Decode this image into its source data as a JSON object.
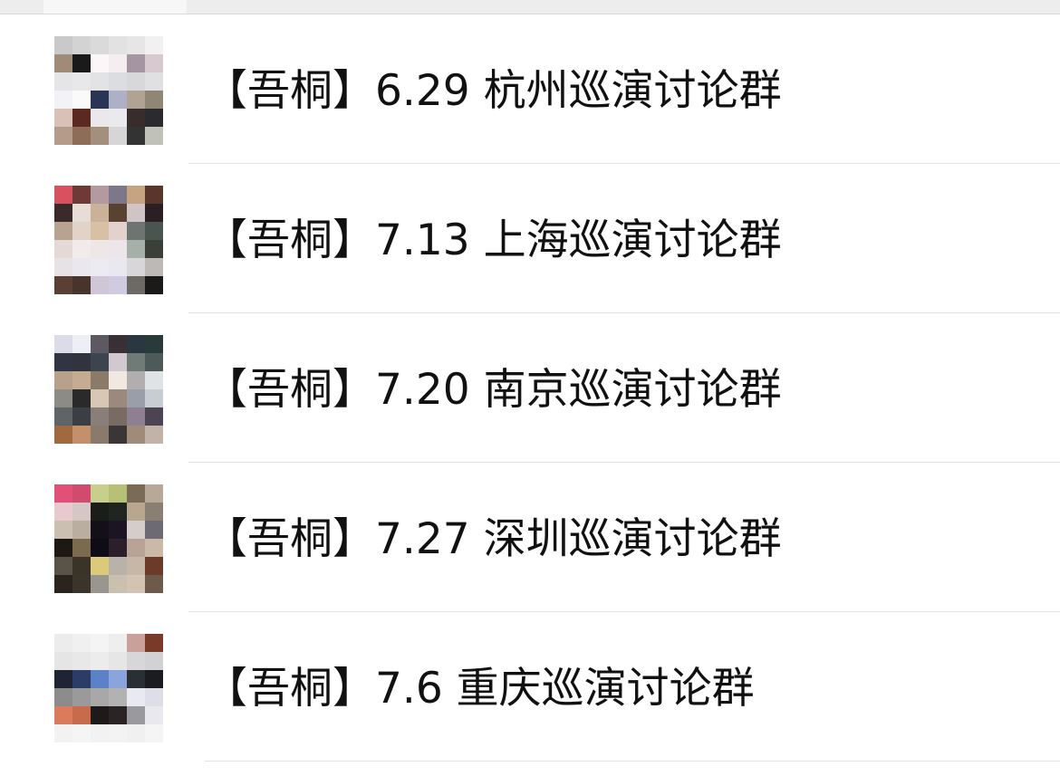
{
  "chat_list": {
    "items": [
      {
        "title": "【吾桐】6.29 杭州巡演讨论群",
        "avatar_colors": [
          "#c9c9c9",
          "#d3d3d3",
          "#dadada",
          "#e2e2e2",
          "#e6e6e6",
          "#f1f1f1",
          "#a08a78",
          "#1a1a1a",
          "#fbf7f8",
          "#f4eef0",
          "#a594a2",
          "#d8c8d0",
          "#e5e5e7",
          "#e8e8ea",
          "#e3e3e6",
          "#dcdde0",
          "#d8d8db",
          "#e0e0e3",
          "#f3f3f7",
          "#fafafa",
          "#2a3556",
          "#aeb0c8",
          "#b0a394",
          "#8f8676",
          "#d9c1b8",
          "#5a2a22",
          "#eae8ea",
          "#e9e9ee",
          "#382c2d",
          "#2b2a2e",
          "#b59b8a",
          "#8e6d58",
          "#a48f7c",
          "#d6d6d6",
          "#333333",
          "#c0c2b8"
        ]
      },
      {
        "title": "【吾桐】7.13 上海巡演讨论群",
        "avatar_colors": [
          "#d9515e",
          "#6f3a36",
          "#b39aa0",
          "#7e7789",
          "#c6a481",
          "#59352c",
          "#3a2a2a",
          "#e7dcd6",
          "#c9b19a",
          "#5a4233",
          "#d0c4c6",
          "#2a1f22",
          "#b8a391",
          "#e2d3c8",
          "#d8c0a5",
          "#e3d1cd",
          "#6e7472",
          "#4a5552",
          "#e4d9d6",
          "#f1ebe9",
          "#eee7e8",
          "#ece6ea",
          "#a6b0ab",
          "#3a3f38",
          "#e6e2e6",
          "#eae8ee",
          "#ecebf1",
          "#e9e8ee",
          "#d9d6da",
          "#bdb9b6",
          "#5a4034",
          "#46342d",
          "#cfc7d8",
          "#d0cbe0",
          "#6d6a66",
          "#1c1a18"
        ]
      },
      {
        "title": "【吾桐】7.20 南京巡演讨论群",
        "avatar_colors": [
          "#dcdbe8",
          "#eeeef6",
          "#5d5963",
          "#3a2f34",
          "#2a3640",
          "#283a3a",
          "#2f3542",
          "#31343e",
          "#3c4450",
          "#d2c9d0",
          "#707a76",
          "#4d5a58",
          "#b8a18c",
          "#c4ab92",
          "#8b7a6a",
          "#f2e8e2",
          "#b2aeb0",
          "#e0e3e6",
          "#8c8c84",
          "#2a2a2a",
          "#d7c7b4",
          "#9a8a7e",
          "#9a9ea8",
          "#c8cdd2",
          "#5f6468",
          "#3b3f45",
          "#8a7e78",
          "#7a6a64",
          "#8e7f92",
          "#4c4453",
          "#a06a3e",
          "#c48f6b",
          "#8a7a6c",
          "#3a3636",
          "#a08b7a",
          "#c2b3a8"
        ]
      },
      {
        "title": "【吾桐】7.27 深圳巡演讨论群",
        "avatar_colors": [
          "#e2507a",
          "#d14b6e",
          "#c8cf8c",
          "#b8c078",
          "#7a6a58",
          "#b8a898",
          "#e8c9d0",
          "#d6c7c6",
          "#1a1d1a",
          "#202520",
          "#b9a68e",
          "#8a7f73",
          "#cabfb1",
          "#b9aea0",
          "#141019",
          "#1b1424",
          "#d3cec9",
          "#6d6a73",
          "#1e1814",
          "#7a6a4e",
          "#0f0b17",
          "#2a1f2b",
          "#b9a397",
          "#cbb9a8",
          "#5a5348",
          "#3a3428",
          "#dcc97a",
          "#b8b2a8",
          "#c7b7a7",
          "#6b3a2a",
          "#2b241c",
          "#3b342a",
          "#98968e",
          "#cbbfb0",
          "#d2c3b3",
          "#6e5a4a"
        ]
      },
      {
        "title": "【吾桐】7.6 重庆巡演讨论群",
        "avatar_colors": [
          "#ececec",
          "#f0f0f0",
          "#f4f4f4",
          "#eeeeee",
          "#c9a09a",
          "#7a3a2a",
          "#e5e5e5",
          "#e8e8e8",
          "#ececec",
          "#e6e6e6",
          "#d7d7d9",
          "#d2d2d4",
          "#1e2434",
          "#2b3c66",
          "#5b82c8",
          "#8aa4dc",
          "#2a2f34",
          "#1a1c20",
          "#8c8c8c",
          "#9a9a9a",
          "#a8a8a8",
          "#b2b2b2",
          "#e9e9f1",
          "#dedee8",
          "#dc7a5c",
          "#c86a4c",
          "#1e1a1a",
          "#2a2424",
          "#9a9a9e",
          "#e8e8ee",
          "#f2f2f2",
          "#f5f5f5",
          "#f2f2f2",
          "#f3f3f3",
          "#f0f0f0",
          "#f5f5f5"
        ]
      }
    ]
  }
}
